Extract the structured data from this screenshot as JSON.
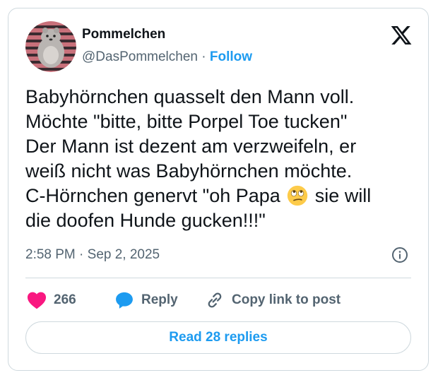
{
  "author": {
    "display_name": "Pommelchen",
    "handle": "@DasPommelchen",
    "separator": "·",
    "follow_label": "Follow"
  },
  "tweet": {
    "line1": "Babyhörnchen quasselt den Mann voll.",
    "line2": "Möchte \"bitte, bitte Porpel Toe tucken\"",
    "line3": "Der Mann ist dezent am verzweifeln, er",
    "line4": "weiß nicht was Babyhörnchen möchte.",
    "line5_before_emoji": "C-Hörnchen genervt \"oh Papa ",
    "line5_after_emoji": " sie will",
    "line6": "die doofen Hunde gucken!!!\"",
    "emoji_name": "face-with-rolling-eyes"
  },
  "meta": {
    "timestamp": "2:58 PM · Sep 2, 2025"
  },
  "actions": {
    "like_count": "266",
    "reply_label": "Reply",
    "copy_label": "Copy link to post"
  },
  "read_replies_label": "Read 28 replies",
  "colors": {
    "accent": "#1d9bf0",
    "like": "#f91880",
    "text": "#0f1419",
    "muted": "#536471",
    "border": "#cfd9de"
  }
}
